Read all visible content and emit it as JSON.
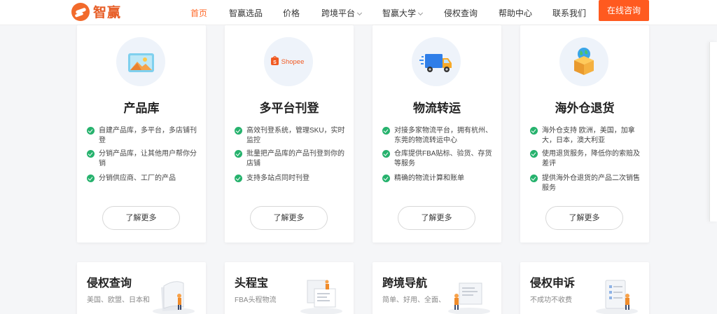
{
  "header": {
    "logo_text": "智赢",
    "nav": [
      {
        "label": "首页",
        "active": true
      },
      {
        "label": "智赢选品",
        "active": false
      },
      {
        "label": "价格",
        "active": false
      },
      {
        "label": "跨境平台",
        "active": false,
        "dropdown": true
      },
      {
        "label": "智赢大学",
        "active": false,
        "dropdown": true
      },
      {
        "label": "侵权查询",
        "active": false
      },
      {
        "label": "帮助中心",
        "active": false
      },
      {
        "label": "联系我们",
        "active": false
      }
    ],
    "consult_label": "在线咨询"
  },
  "cards": [
    {
      "icon": "image-gallery-icon",
      "title": "产品库",
      "features": [
        "自建产品库，多平台，多店铺刊登",
        "分销产品库，让其他用户帮你分销",
        "分销供应商、工厂的产品"
      ],
      "button": "了解更多"
    },
    {
      "icon": "shopee-bag-icon",
      "icon_text": "Shopee",
      "title": "多平台刊登",
      "features": [
        "高效刊登系统，管理SKU，实时监控",
        "批量把产品库的产品刊登到你的店铺",
        "支持多站点同时刊登"
      ],
      "button": "了解更多"
    },
    {
      "icon": "delivery-truck-icon",
      "title": "物流转运",
      "features": [
        "对接多家物流平台，拥有杭州、东莞的物流转运中心",
        "仓库提供FBA贴标、验货、存货等服务",
        "精确的物流计算和账单"
      ],
      "button": "了解更多"
    },
    {
      "icon": "globe-box-icon",
      "title": "海外仓退货",
      "features": [
        "海外仓支持 欧洲，美国，加拿大，日本，澳大利亚",
        "使用退货服务，降低你的索赔及差评",
        "提供海外仓退货的产品二次销售服务"
      ],
      "button": "了解更多"
    }
  ],
  "bottom_cards": [
    {
      "title": "侵权查询",
      "subtitle": "美国、欧盟、日本和",
      "icon": "document-person-icon"
    },
    {
      "title": "头程宝",
      "subtitle": "FBA头程物流",
      "icon": "shipping-forms-icon"
    },
    {
      "title": "跨境导航",
      "subtitle": "简单、好用、全面、",
      "icon": "navigation-board-icon"
    },
    {
      "title": "侵权申诉",
      "subtitle": "不成功不收费",
      "icon": "checklist-person-icon"
    }
  ],
  "colors": {
    "accent": "#ff5a1f",
    "check": "#26b26d",
    "brand": "#e75c24"
  }
}
